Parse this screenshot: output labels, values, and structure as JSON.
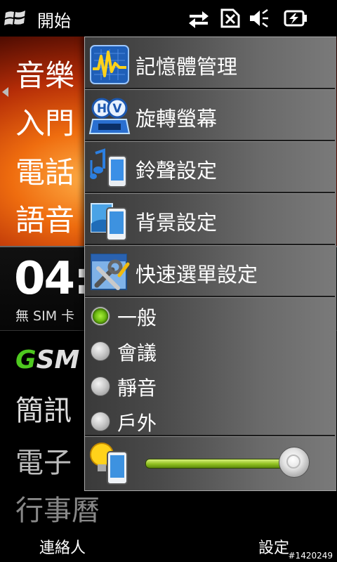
{
  "statusbar": {
    "start_label": "開始",
    "icons": [
      "windows-flag-icon",
      "data-transfer-icon",
      "no-sim-icon",
      "volume-muted-icon",
      "battery-charging-icon"
    ]
  },
  "home": {
    "menu_items": [
      "音樂",
      "入門",
      "電話",
      "語音"
    ],
    "clock": "04:",
    "sim_status": "無 SIM 卡",
    "brand_logo": "GSM",
    "lower_items": [
      "簡訊",
      "電子",
      "行事曆"
    ]
  },
  "quick_menu": {
    "items": [
      {
        "label": "記憶體管理",
        "icon": "memory-graph-icon"
      },
      {
        "label": "旋轉螢幕",
        "icon": "rotate-screen-icon"
      },
      {
        "label": "鈴聲設定",
        "icon": "ringtone-icon"
      },
      {
        "label": "背景設定",
        "icon": "wallpaper-icon"
      },
      {
        "label": "快速選單設定",
        "icon": "quickmenu-tools-icon"
      }
    ],
    "profiles": [
      {
        "label": "一般",
        "selected": true
      },
      {
        "label": "會議",
        "selected": false
      },
      {
        "label": "靜音",
        "selected": false
      },
      {
        "label": "戶外",
        "selected": false
      }
    ],
    "brightness": {
      "icon": "brightness-bulb-icon",
      "level": 0.95
    }
  },
  "softkeys": {
    "left": "連絡人",
    "right": "設定"
  },
  "watermark": "#1420249",
  "colors": {
    "accent_green": "#6dbb12",
    "hero_orange": "#ef6d0f"
  }
}
